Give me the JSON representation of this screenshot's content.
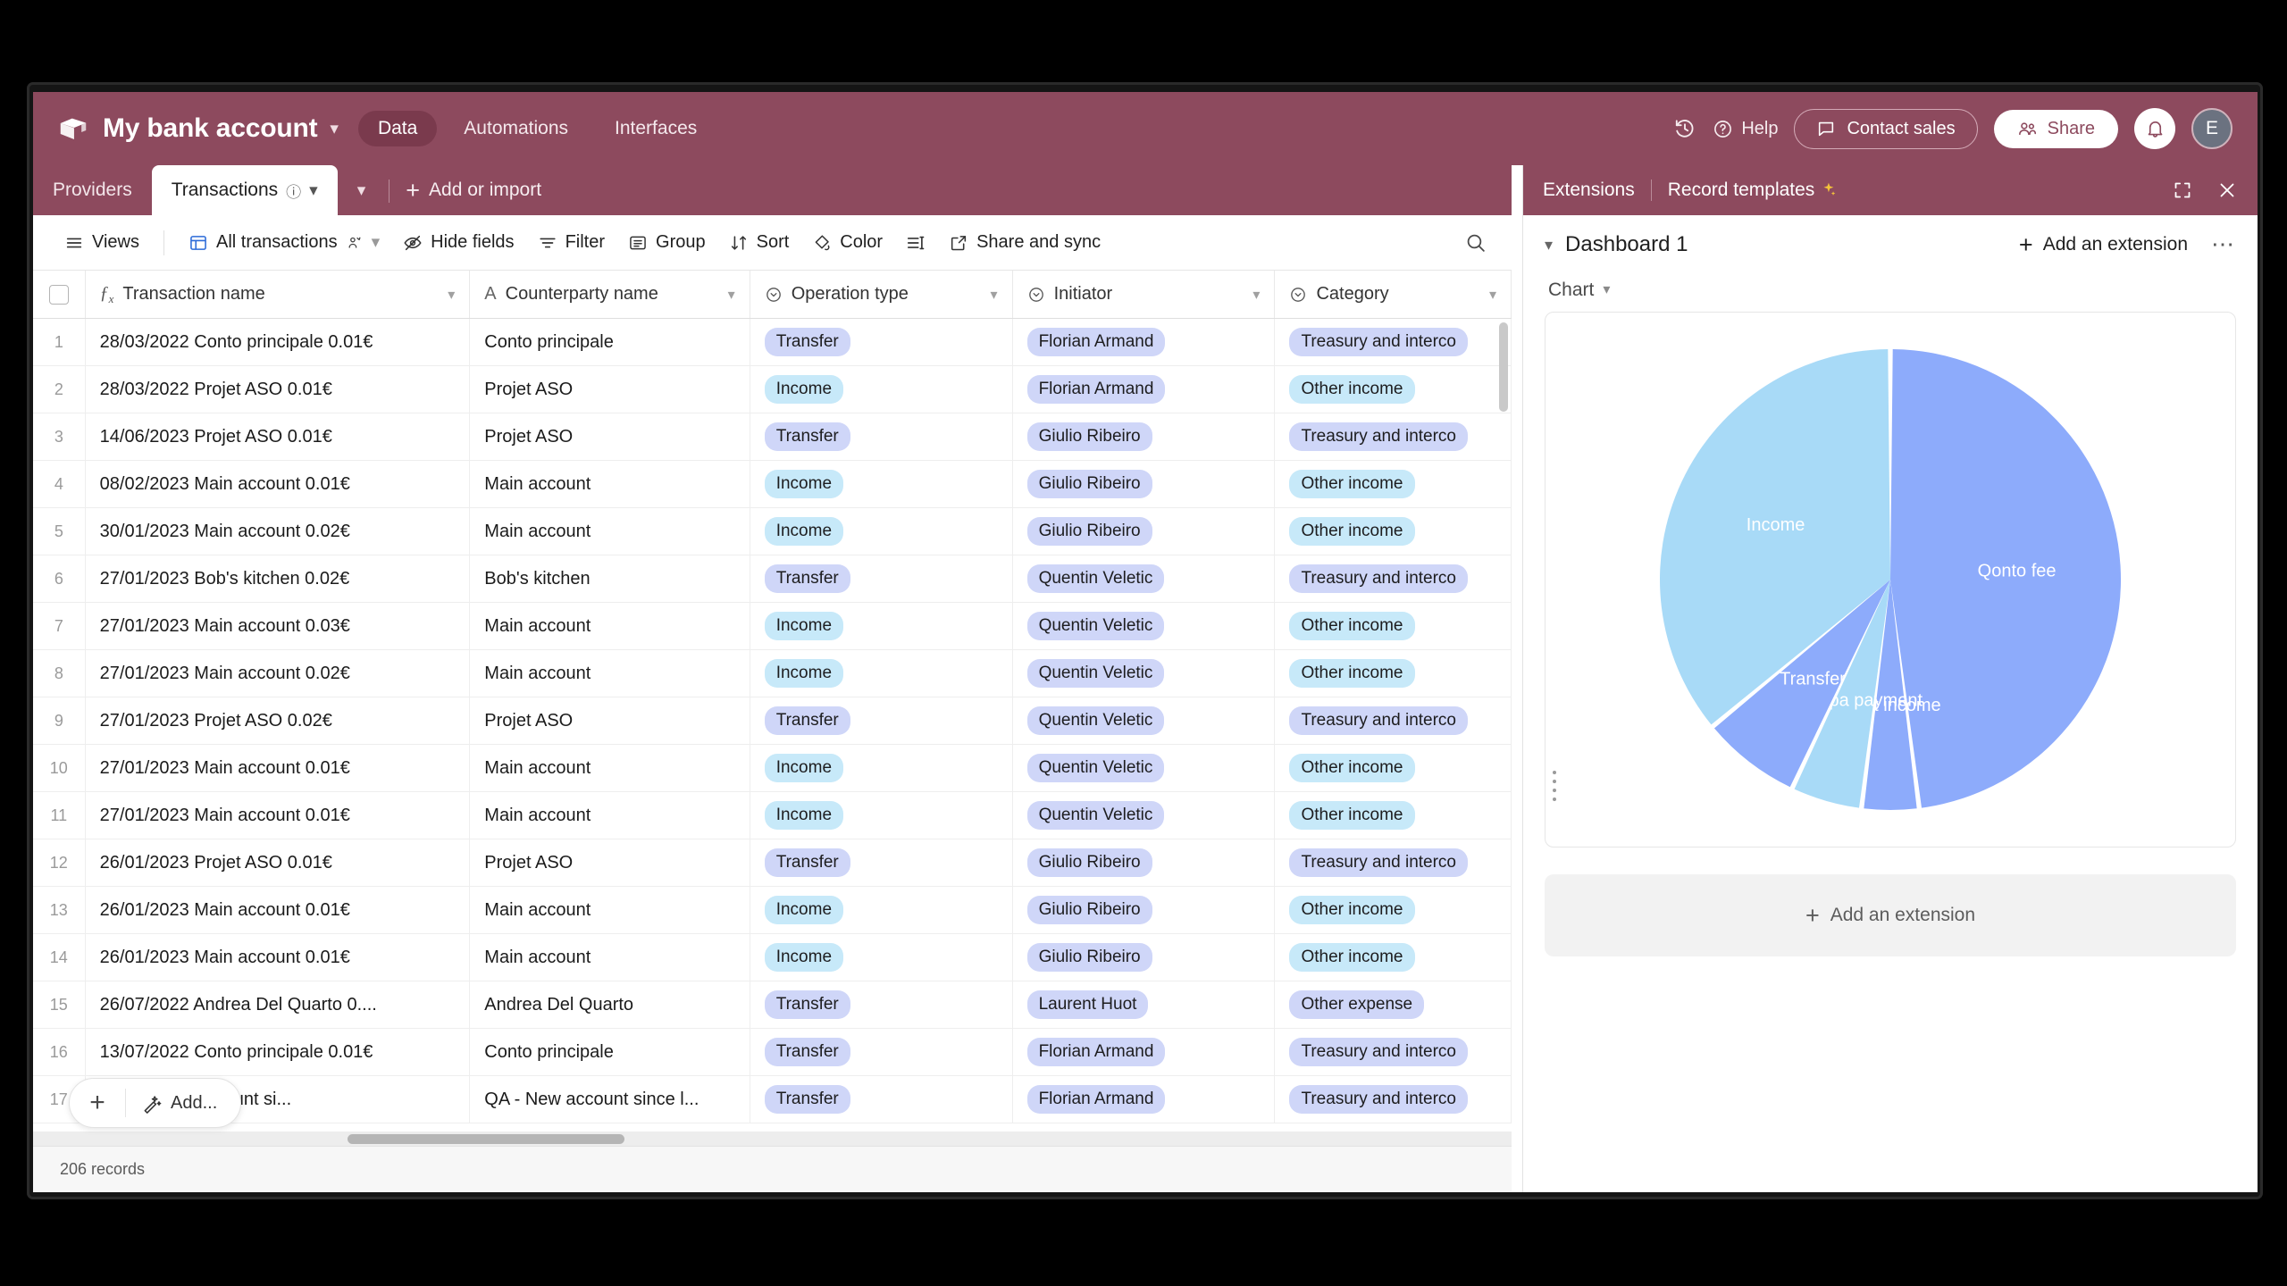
{
  "app": {
    "base_title": "My bank account",
    "base_icon": "cube-icon",
    "tabs": [
      {
        "label": "Data",
        "active": true
      },
      {
        "label": "Automations",
        "active": false
      },
      {
        "label": "Interfaces",
        "active": false
      }
    ],
    "right": {
      "history_icon": "history-icon",
      "help_label": "Help",
      "contact_sales_label": "Contact sales",
      "share_label": "Share",
      "notifications_icon": "bell-icon",
      "avatar_initial": "E"
    },
    "accent_color": "#8d4a5e"
  },
  "table_tabs": {
    "items": [
      {
        "label": "Providers",
        "active": false
      },
      {
        "label": "Transactions",
        "active": true
      }
    ],
    "add_label": "Add or import"
  },
  "toolbar": {
    "views_label": "Views",
    "view_name": "All transactions",
    "hide_fields_label": "Hide fields",
    "filter_label": "Filter",
    "group_label": "Group",
    "sort_label": "Sort",
    "color_label": "Color",
    "row_height_icon": "row-height-icon",
    "share_sync_label": "Share and sync",
    "search_icon": "search-icon"
  },
  "grid": {
    "columns": [
      {
        "label": "Transaction name",
        "type_icon": "formula-icon"
      },
      {
        "label": "Counterparty name",
        "type_icon": "text-icon"
      },
      {
        "label": "Operation type",
        "type_icon": "single-select-icon"
      },
      {
        "label": "Initiator",
        "type_icon": "single-select-icon"
      },
      {
        "label": "Category",
        "type_icon": "single-select-icon"
      }
    ],
    "rows": [
      {
        "n": "1",
        "name": "28/03/2022 Conto principale 0.01€",
        "party": "Conto principale",
        "op": "Transfer",
        "op_color": "periwinkle",
        "init": "Florian Armand",
        "cat": "Treasury and interco",
        "cat_color": "periwinkle"
      },
      {
        "n": "2",
        "name": "28/03/2022 Projet ASO 0.01€",
        "party": "Projet ASO",
        "op": "Income",
        "op_color": "cyan",
        "init": "Florian Armand",
        "cat": "Other income",
        "cat_color": "cyan"
      },
      {
        "n": "3",
        "name": "14/06/2023 Projet ASO 0.01€",
        "party": "Projet ASO",
        "op": "Transfer",
        "op_color": "periwinkle",
        "init": "Giulio Ribeiro",
        "cat": "Treasury and interco",
        "cat_color": "periwinkle"
      },
      {
        "n": "4",
        "name": "08/02/2023 Main account 0.01€",
        "party": "Main account",
        "op": "Income",
        "op_color": "cyan",
        "init": "Giulio Ribeiro",
        "cat": "Other income",
        "cat_color": "cyan"
      },
      {
        "n": "5",
        "name": "30/01/2023 Main account 0.02€",
        "party": "Main account",
        "op": "Income",
        "op_color": "cyan",
        "init": "Giulio Ribeiro",
        "cat": "Other income",
        "cat_color": "cyan"
      },
      {
        "n": "6",
        "name": "27/01/2023 Bob's kitchen 0.02€",
        "party": "Bob's kitchen",
        "op": "Transfer",
        "op_color": "periwinkle",
        "init": "Quentin Veletic",
        "cat": "Treasury and interco",
        "cat_color": "periwinkle"
      },
      {
        "n": "7",
        "name": "27/01/2023 Main account 0.03€",
        "party": "Main account",
        "op": "Income",
        "op_color": "cyan",
        "init": "Quentin Veletic",
        "cat": "Other income",
        "cat_color": "cyan"
      },
      {
        "n": "8",
        "name": "27/01/2023 Main account 0.02€",
        "party": "Main account",
        "op": "Income",
        "op_color": "cyan",
        "init": "Quentin Veletic",
        "cat": "Other income",
        "cat_color": "cyan"
      },
      {
        "n": "9",
        "name": "27/01/2023 Projet ASO 0.02€",
        "party": "Projet ASO",
        "op": "Transfer",
        "op_color": "periwinkle",
        "init": "Quentin Veletic",
        "cat": "Treasury and interco",
        "cat_color": "periwinkle"
      },
      {
        "n": "10",
        "name": "27/01/2023 Main account 0.01€",
        "party": "Main account",
        "op": "Income",
        "op_color": "cyan",
        "init": "Quentin Veletic",
        "cat": "Other income",
        "cat_color": "cyan"
      },
      {
        "n": "11",
        "name": "27/01/2023 Main account 0.01€",
        "party": "Main account",
        "op": "Income",
        "op_color": "cyan",
        "init": "Quentin Veletic",
        "cat": "Other income",
        "cat_color": "cyan"
      },
      {
        "n": "12",
        "name": "26/01/2023 Projet ASO 0.01€",
        "party": "Projet ASO",
        "op": "Transfer",
        "op_color": "periwinkle",
        "init": "Giulio Ribeiro",
        "cat": "Treasury and interco",
        "cat_color": "periwinkle"
      },
      {
        "n": "13",
        "name": "26/01/2023 Main account 0.01€",
        "party": "Main account",
        "op": "Income",
        "op_color": "cyan",
        "init": "Giulio Ribeiro",
        "cat": "Other income",
        "cat_color": "cyan"
      },
      {
        "n": "14",
        "name": "26/01/2023 Main account 0.01€",
        "party": "Main account",
        "op": "Income",
        "op_color": "cyan",
        "init": "Giulio Ribeiro",
        "cat": "Other income",
        "cat_color": "cyan"
      },
      {
        "n": "15",
        "name": "26/07/2022 Andrea Del Quarto 0....",
        "party": "Andrea Del Quarto",
        "op": "Transfer",
        "op_color": "periwinkle",
        "init": "Laurent Huot",
        "cat": "Other expense",
        "cat_color": "periwinkle"
      },
      {
        "n": "16",
        "name": "13/07/2022 Conto principale 0.01€",
        "party": "Conto principale",
        "op": "Transfer",
        "op_color": "periwinkle",
        "init": "Florian Armand",
        "cat": "Treasury and interco",
        "cat_color": "periwinkle"
      },
      {
        "n": "17",
        "name": "2 QA - New account si...",
        "party": "QA - New account since l...",
        "op": "Transfer",
        "op_color": "periwinkle",
        "init": "Florian Armand",
        "cat": "Treasury and interco",
        "cat_color": "periwinkle"
      }
    ],
    "add_row_label": "Add...",
    "record_count": "206 records"
  },
  "extensions": {
    "tab_extensions": "Extensions",
    "tab_record_templates": "Record templates",
    "sparkle_icon": "sparkle-icon",
    "expand_icon": "expand-icon",
    "close_icon": "close-icon",
    "dashboard_title": "Dashboard 1",
    "add_extension_label": "Add an extension",
    "more_icon": "more-icon",
    "chart_label": "Chart",
    "add_extension_big_label": "Add an extension"
  },
  "chart_data": {
    "type": "pie",
    "title": "Chart",
    "legend": "none",
    "labels": [
      "Qonto fee",
      "Swift income",
      "Pagopa payment",
      "Transfer",
      "Income"
    ],
    "values": [
      48,
      4,
      5,
      7,
      36
    ],
    "colors": [
      "#8dabfb",
      "#8dabfb",
      "#a8daf7",
      "#8dabfb",
      "#a8daf7"
    ],
    "label_colors": [
      "#ffffff",
      "#ffffff",
      "#ffffff",
      "#ffffff",
      "#ffffff"
    ],
    "slice_gap_deg": 1.2,
    "start_angle_deg": 0
  }
}
